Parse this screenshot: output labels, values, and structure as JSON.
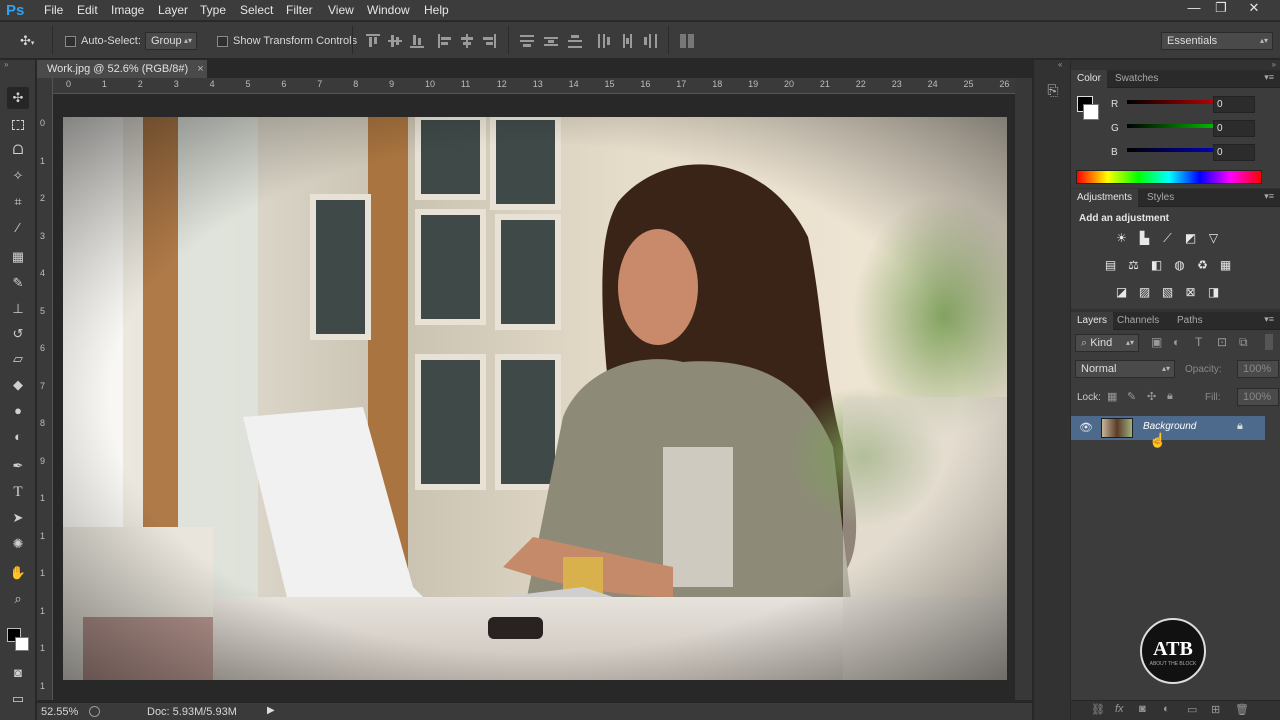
{
  "app": {
    "logo": "Ps"
  },
  "menu": [
    "File",
    "Edit",
    "Image",
    "Layer",
    "Type",
    "Select",
    "Filter",
    "View",
    "Window",
    "Help"
  ],
  "window_controls": {
    "minimize": "—",
    "restore": "❐",
    "close": "✕"
  },
  "options": {
    "auto_select_label": "Auto-Select:",
    "auto_select_checked": false,
    "group_value": "Group",
    "transform_label": "Show Transform Controls",
    "transform_checked": false,
    "workspace": "Essentials"
  },
  "document": {
    "tab_title": "Work.jpg @ 52.6% (RGB/8#)",
    "close_glyph": "×",
    "ruler_h": [
      "0",
      "1",
      "2",
      "3",
      "4",
      "5",
      "6",
      "7",
      "8",
      "9",
      "10",
      "11",
      "12",
      "13",
      "14",
      "15",
      "16",
      "17",
      "18",
      "19",
      "20",
      "21",
      "22",
      "23",
      "24",
      "25",
      "26"
    ],
    "ruler_v": [
      "0",
      "1",
      "2",
      "3",
      "4",
      "5",
      "6",
      "7",
      "8",
      "9",
      "1",
      "1",
      "1",
      "1",
      "1",
      "1"
    ]
  },
  "status": {
    "zoom": "52.55%",
    "doc": "Doc: 5.93M/5.93M"
  },
  "color_panel": {
    "tabs": [
      "Color",
      "Swatches"
    ],
    "channels": [
      {
        "label": "R",
        "value": "0"
      },
      {
        "label": "G",
        "value": "0"
      },
      {
        "label": "B",
        "value": "0"
      }
    ]
  },
  "adjustments_panel": {
    "tabs": [
      "Adjustments",
      "Styles"
    ],
    "title": "Add an adjustment"
  },
  "layers_panel": {
    "tabs": [
      "Layers",
      "Channels",
      "Paths"
    ],
    "filter_kind": "Kind",
    "blend_mode": "Normal",
    "opacity_label": "Opacity:",
    "opacity_value": "100%",
    "lock_label": "Lock:",
    "fill_label": "Fill:",
    "fill_value": "100%",
    "layers": [
      {
        "name": "Background",
        "visible": true,
        "locked": true
      }
    ]
  },
  "watermark": {
    "text": "ATB",
    "subtext": "ABOUT THE BLOCK"
  }
}
